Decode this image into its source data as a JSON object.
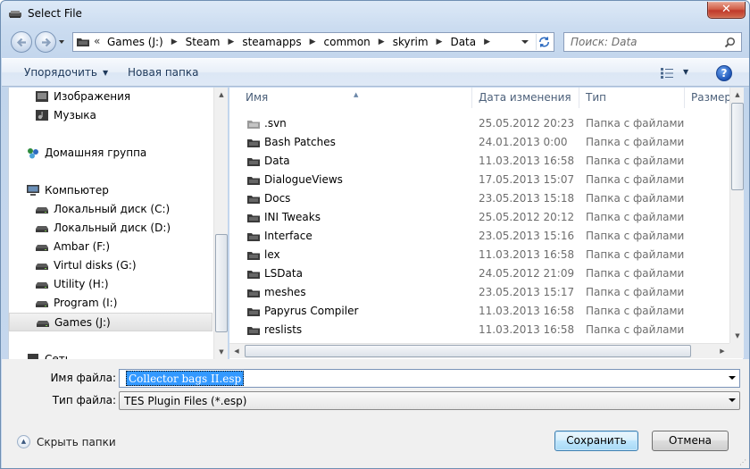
{
  "window": {
    "title": "Select File"
  },
  "address": {
    "crumbs": [
      "Games (J:)",
      "Steam",
      "steamapps",
      "common",
      "skyrim",
      "Data"
    ],
    "overflow_glyph": "«"
  },
  "search": {
    "placeholder": "Поиск: Data"
  },
  "toolbar": {
    "organize": "Упорядочить",
    "new_folder": "Новая папка",
    "help": "?"
  },
  "nav": {
    "items": [
      {
        "label": "Изображения",
        "icon": "pictures-icon",
        "indent": 1
      },
      {
        "label": "Музыка",
        "icon": "music-icon",
        "indent": 1
      },
      {
        "label": "Домашняя группа",
        "icon": "homegroup-icon",
        "indent": 0
      },
      {
        "label": "Компьютер",
        "icon": "computer-icon",
        "indent": 0
      },
      {
        "label": "Локальный диск (C:)",
        "icon": "drive-icon",
        "indent": 1
      },
      {
        "label": "Локальный диск (D:)",
        "icon": "drive-icon",
        "indent": 1
      },
      {
        "label": "Ambar (F:)",
        "icon": "drive-icon",
        "indent": 1
      },
      {
        "label": "Virtul disks (G:)",
        "icon": "drive-icon",
        "indent": 1
      },
      {
        "label": "Utility (H:)",
        "icon": "drive-icon",
        "indent": 1
      },
      {
        "label": "Program (I:)",
        "icon": "drive-icon",
        "indent": 1
      },
      {
        "label": "Games (J:)",
        "icon": "drive-icon",
        "indent": 1,
        "selected": true
      },
      {
        "label": "Сеть",
        "icon": "network-icon",
        "indent": 0
      }
    ]
  },
  "columns": {
    "name": "Имя",
    "date": "Дата изменения",
    "type": "Тип",
    "size": "Размер"
  },
  "files": [
    {
      "name": ".svn",
      "date": "25.05.2012 20:23",
      "type": "Папка с файлами",
      "hidden": true
    },
    {
      "name": "Bash Patches",
      "date": "24.01.2013 0:00",
      "type": "Папка с файлами"
    },
    {
      "name": "Data",
      "date": "11.03.2013 16:58",
      "type": "Папка с файлами"
    },
    {
      "name": "DialogueViews",
      "date": "17.05.2013 15:07",
      "type": "Папка с файлами"
    },
    {
      "name": "Docs",
      "date": "23.05.2013 15:18",
      "type": "Папка с файлами"
    },
    {
      "name": "INI Tweaks",
      "date": "25.05.2012 20:12",
      "type": "Папка с файлами"
    },
    {
      "name": "Interface",
      "date": "23.05.2013 15:16",
      "type": "Папка с файлами"
    },
    {
      "name": "lex",
      "date": "11.03.2013 16:58",
      "type": "Папка с файлами"
    },
    {
      "name": "LSData",
      "date": "24.05.2012 21:09",
      "type": "Папка с файлами"
    },
    {
      "name": "meshes",
      "date": "23.05.2013 15:17",
      "type": "Папка с файлами"
    },
    {
      "name": "Papyrus Compiler",
      "date": "11.03.2013 16:58",
      "type": "Папка с файлами"
    },
    {
      "name": "reslists",
      "date": "11.03.2013 16:58",
      "type": "Папка с файлами"
    }
  ],
  "form": {
    "filename_label": "Имя файла:",
    "filename_value": "Collector bags II.esp",
    "filetype_label": "Тип файла:",
    "filetype_value": "TES Plugin Files (*.esp)"
  },
  "footer": {
    "hide_folders": "Скрыть папки",
    "save": "Сохранить",
    "cancel": "Отмена"
  },
  "colors": {
    "accent": "#3399ff",
    "frame": "#c2d5ec",
    "close": "#c0392b",
    "folder": "#3a3a3a"
  }
}
